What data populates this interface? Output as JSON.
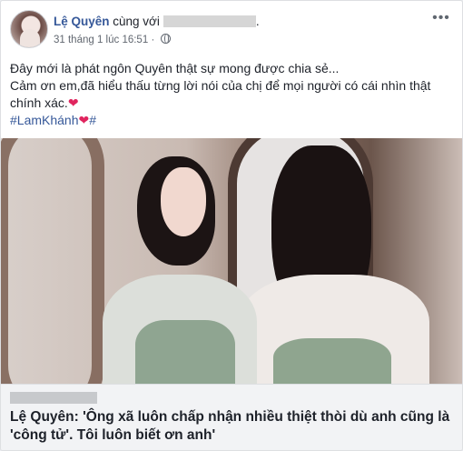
{
  "post": {
    "author": "Lệ Quyên",
    "with_text": "cùng với",
    "timestamp": "31 tháng 1 lúc 16:51",
    "dot": "·",
    "more_icon": "more-horizontal-icon",
    "privacy_icon": "globe-icon",
    "text_line1": "Đây mới là phát ngôn Quyên thật sự mong được chia sẻ...",
    "text_line2": "Cảm ơn em,đã hiểu thấu từng lời nói của chị để mọi người có cái nhìn thật chính xác.",
    "heart": "❤",
    "hashtag": "#LamKhánh",
    "hash_end": "#",
    "link_title": "Lệ Quyên: 'Ông xã luôn chấp nhận nhiều thiệt thòi dù anh cũng là 'công tử'. Tôi luôn biết ơn anh'"
  },
  "colors": {
    "link": "#365899",
    "heart": "#e0245e",
    "text": "#1d2129",
    "meta": "#616770"
  }
}
